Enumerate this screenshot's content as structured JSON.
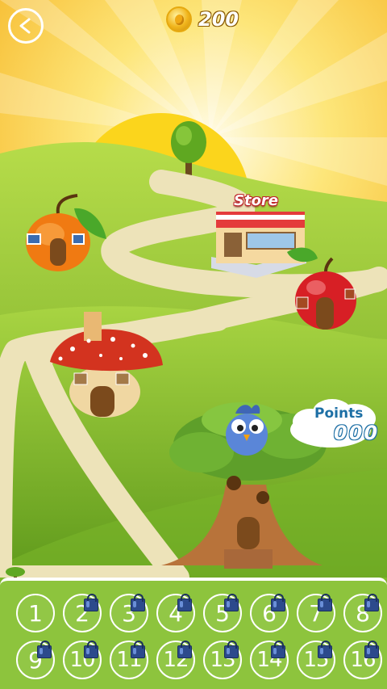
{
  "hud": {
    "back_icon": "back-arrow-icon",
    "coins": "200"
  },
  "store": {
    "label": "Store"
  },
  "points": {
    "label": "Points",
    "value": "000"
  },
  "levels": [
    {
      "n": "1",
      "locked": false
    },
    {
      "n": "2",
      "locked": true
    },
    {
      "n": "3",
      "locked": true
    },
    {
      "n": "4",
      "locked": true
    },
    {
      "n": "5",
      "locked": true
    },
    {
      "n": "6",
      "locked": true
    },
    {
      "n": "7",
      "locked": true
    },
    {
      "n": "8",
      "locked": true
    },
    {
      "n": "9",
      "locked": true
    },
    {
      "n": "10",
      "locked": true
    },
    {
      "n": "11",
      "locked": true
    },
    {
      "n": "12",
      "locked": true
    },
    {
      "n": "13",
      "locked": true
    },
    {
      "n": "14",
      "locked": true
    },
    {
      "n": "15",
      "locked": true
    },
    {
      "n": "16",
      "locked": true
    }
  ],
  "colors": {
    "sky_top": "#f7c51a",
    "grass": "#8dc43d",
    "path": "#ede3b9",
    "coin": "#f1b51c"
  }
}
